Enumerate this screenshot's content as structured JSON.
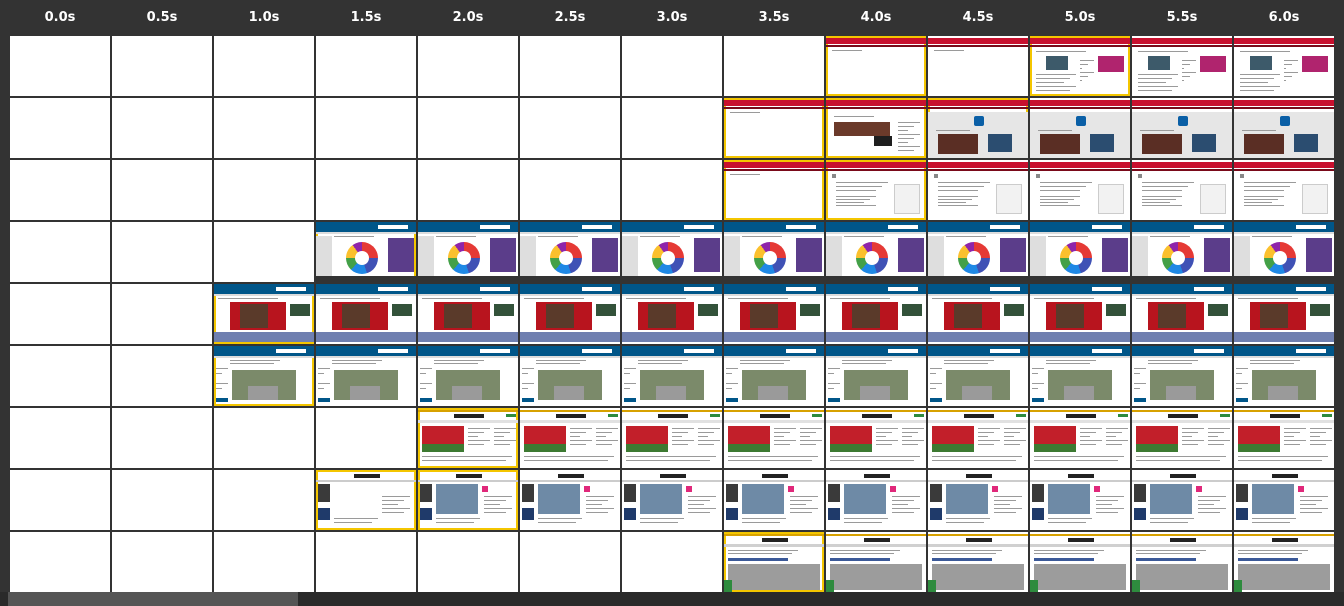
{
  "timeline": {
    "labels": [
      "0.0s",
      "0.5s",
      "1.0s",
      "1.5s",
      "2.0s",
      "2.5s",
      "3.0s",
      "3.5s",
      "4.0s",
      "4.5s",
      "5.0s",
      "5.5s",
      "6.0s"
    ]
  },
  "rows": [
    {
      "name": "row-1",
      "frames": [
        "blank",
        "blank",
        "blank",
        "blank",
        "blank",
        "blank",
        "blank",
        "blank",
        "redhdr",
        "redhdr",
        "news-ad",
        "news-ad",
        "news-ad"
      ]
    },
    {
      "name": "row-2",
      "frames": [
        "blank",
        "blank",
        "blank",
        "blank",
        "blank",
        "blank",
        "blank",
        "redhdr",
        "news-video",
        "edx",
        "edx",
        "edx",
        "edx"
      ]
    },
    {
      "name": "row-3",
      "frames": [
        "blank",
        "blank",
        "blank",
        "blank",
        "blank",
        "blank",
        "blank",
        "redhdr",
        "article",
        "article",
        "article",
        "article",
        "article"
      ]
    },
    {
      "name": "row-4",
      "frames": [
        "blank",
        "blank",
        "blank",
        "guardian-chart",
        "guardian-chart",
        "guardian-chart",
        "guardian-chart",
        "guardian-chart",
        "guardian-chart",
        "guardian-chart",
        "guardian-chart",
        "guardian-chart",
        "guardian-chart"
      ]
    },
    {
      "name": "row-5",
      "frames": [
        "blank",
        "blank",
        "guardian-red",
        "guardian-red",
        "guardian-red",
        "guardian-red",
        "guardian-red",
        "guardian-red",
        "guardian-red",
        "guardian-red",
        "guardian-red",
        "guardian-red",
        "guardian-red"
      ]
    },
    {
      "name": "row-6",
      "frames": [
        "blank",
        "blank",
        "guardian-road",
        "guardian-road",
        "guardian-road",
        "guardian-road",
        "guardian-road",
        "guardian-road",
        "guardian-road",
        "guardian-road",
        "guardian-road",
        "guardian-road",
        "guardian-road"
      ]
    },
    {
      "name": "row-7",
      "frames": [
        "blank",
        "blank",
        "blank",
        "blank",
        "sports",
        "sports",
        "sports",
        "sports",
        "sports",
        "sports",
        "sports",
        "sports",
        "sports"
      ]
    },
    {
      "name": "row-8",
      "frames": [
        "blank",
        "blank",
        "blank",
        "indep-partial",
        "indep",
        "indep",
        "indep",
        "indep",
        "indep",
        "indep",
        "indep",
        "indep",
        "indep"
      ]
    },
    {
      "name": "row-9",
      "frames": [
        "blank",
        "blank",
        "blank",
        "blank",
        "blank",
        "blank",
        "blank",
        "indep-mobile",
        "indep-mobile",
        "indep-mobile",
        "indep-mobile",
        "indep-mobile",
        "indep-mobile"
      ]
    }
  ],
  "colors": {
    "background": "#333333",
    "frame_bg": "#ffffff",
    "red_header": "#c8102e",
    "guardian_blue": "#005689",
    "green_bar": "#2e8b3e",
    "highlight": "#f4c600"
  }
}
